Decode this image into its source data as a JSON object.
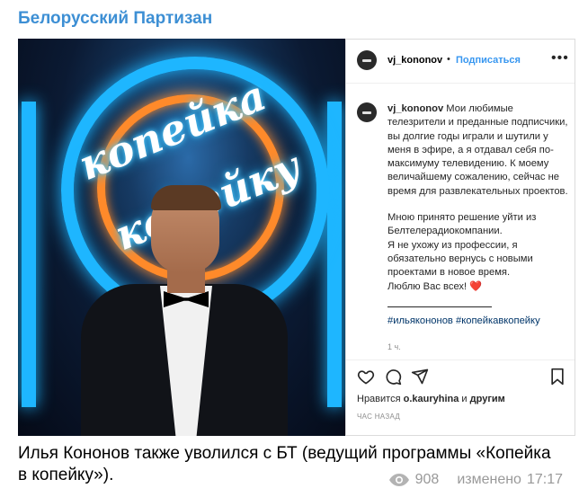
{
  "channel": {
    "title": "Белорусский Партизан"
  },
  "photo": {
    "neon_line1": "копейка",
    "neon_line2": "в",
    "neon_line3": "копейку"
  },
  "instagram": {
    "username": "vj_kononov",
    "dot": "•",
    "follow_label": "Подписаться",
    "more_label": "•••",
    "caption_username": "vj_kononov",
    "caption_p1": "Мои любимые телезрители и преданные подписчики, вы долгие годы играли и шутили у меня в эфире, а я отдавал себя по-максимуму телевидению. К моему величайшему сожалению, сейчас не время для развлекательных проектов.",
    "caption_p2": "Мною принято решение уйти из Белтелерадиокомпании.",
    "caption_p3": "Я не ухожу из профессии, я обязательно вернусь с новыми проектами в новое время.",
    "caption_p4": "Люблю Вас всех! ❤️",
    "hashtags": "#ильякононов #копейкавкопейку",
    "caption_time": "1 ч.",
    "likes_prefix": "Нравится",
    "likes_user": "o.kauryhina",
    "likes_suffix": "и",
    "likes_others": "другим",
    "post_time": "ЧАС НАЗАД"
  },
  "message": {
    "text": "Илья Кононов также уволился с БТ (ведущий программы «Копейка в копейку»).",
    "views": "908",
    "edited_label": "изменено",
    "time": "17:17"
  },
  "colors": {
    "channel_title": "#3d8fd4",
    "link": "#3897f0",
    "meta": "#999999"
  }
}
